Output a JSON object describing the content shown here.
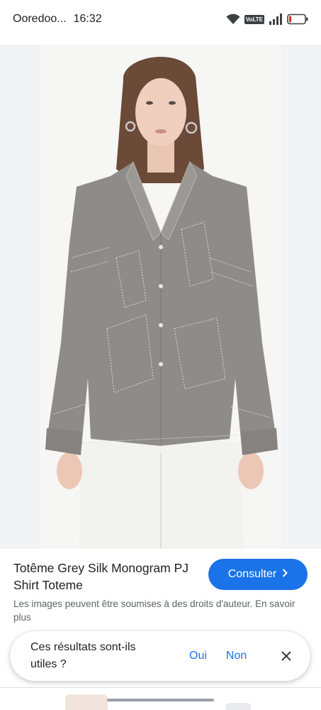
{
  "status_bar": {
    "carrier": "Ooredoo...",
    "time": "16:32",
    "volte": "VoLTE",
    "battery_level": 0.15
  },
  "image": {
    "alt": "Totême Grey Silk Monogram PJ Shirt Toteme"
  },
  "product": {
    "title": "Totême Grey Silk Monogram PJ Shirt Toteme",
    "consult_label": "Consulter",
    "copyright_notice": "Les images peuvent être soumises à des droits d'auteur.",
    "learn_more": "En savoir plus"
  },
  "feedback": {
    "question": "Ces résultats sont-ils utiles ?",
    "yes": "Oui",
    "no": "Non"
  },
  "colors": {
    "accent": "#1a73e8",
    "shirt": "#8f8b88"
  }
}
